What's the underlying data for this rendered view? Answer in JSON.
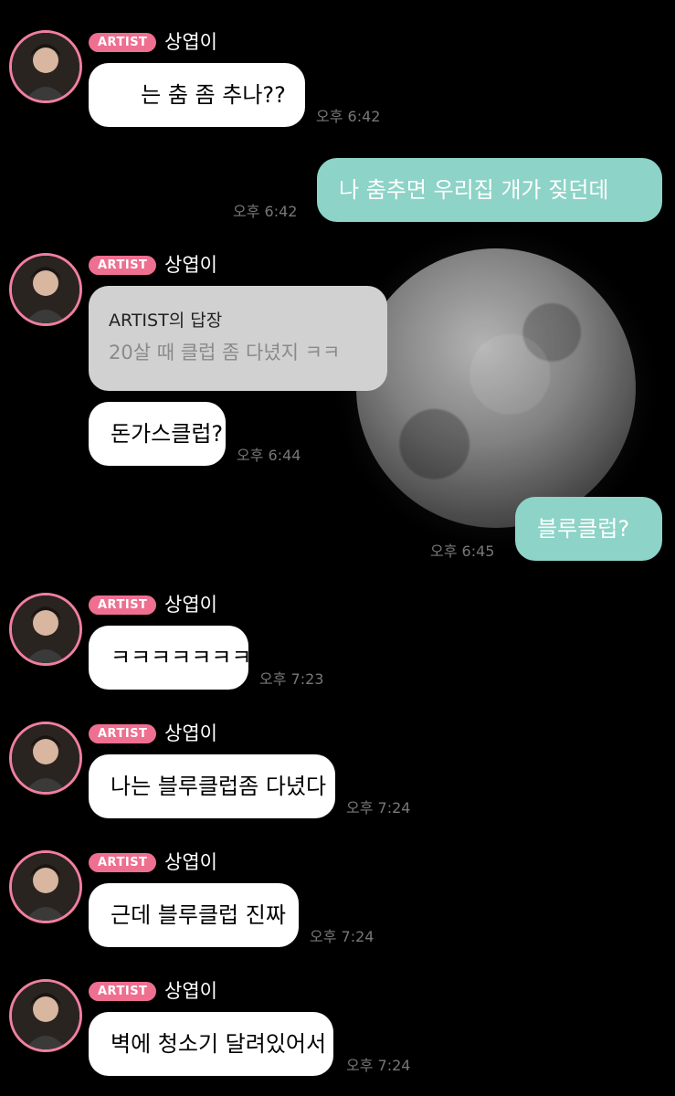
{
  "app": {
    "accent_color": "#ef6f90",
    "outgoing_bubble_color": "#8dd3c7",
    "incoming_bubble_color": "#ffffff",
    "background_image": "full-moon"
  },
  "sender": {
    "name": "상엽이",
    "badge": "ARTIST"
  },
  "messages": [
    {
      "direction": "in",
      "text": "는 춤 좀 추나??",
      "time": "오후 6:42"
    },
    {
      "direction": "out",
      "text": "나 춤추면 우리집 개가 짖던데",
      "time": "오후 6:42"
    },
    {
      "direction": "in",
      "reply_title": "ARTIST의 답장",
      "reply_text": "20살 때 클럽 좀 다녔지 ㅋㅋ"
    },
    {
      "direction": "in",
      "text": "돈가스클럽?",
      "time": "오후 6:44"
    },
    {
      "direction": "out",
      "text": "블루클럽?",
      "time": "오후 6:45"
    },
    {
      "direction": "in",
      "text": "ㅋㅋㅋㅋㅋㅋㅋㅋ",
      "time": "오후 7:23"
    },
    {
      "direction": "in",
      "text": "나는 블루클럽좀 다녔다",
      "time": "오후 7:24"
    },
    {
      "direction": "in",
      "text": "근데 블루클럽 진짜",
      "time": "오후 7:24"
    },
    {
      "direction": "in",
      "text": "벽에 청소기 달려있어서",
      "time": "오후 7:24"
    }
  ]
}
